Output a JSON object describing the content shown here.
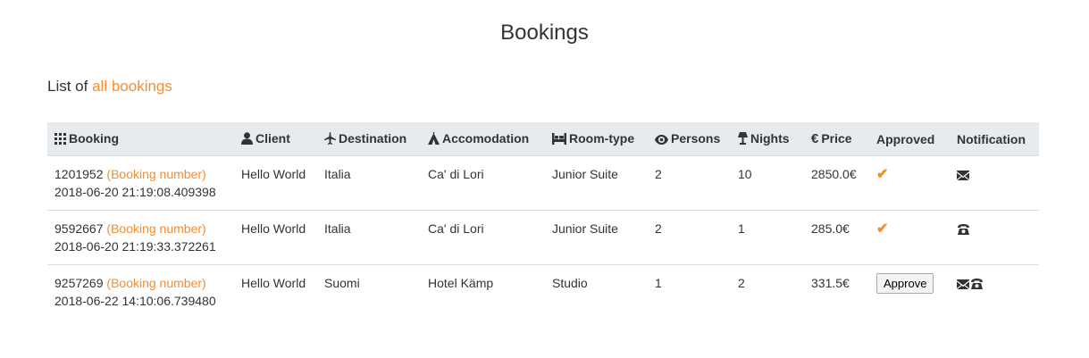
{
  "page": {
    "title": "Bookings"
  },
  "subtitle": {
    "prefix": "List of",
    "accent": "all bookings",
    "accent_color": "#f68c30"
  },
  "table": {
    "headers": {
      "booking": "Booking",
      "client": "Client",
      "destination": "Destination",
      "accommodation": "Accomodation",
      "room_type": "Room-type",
      "persons": "Persons",
      "nights": "Nights",
      "price": "Price",
      "approved": "Approved",
      "notification": "Notification"
    },
    "header_icons": {
      "booking": "grid-icon",
      "client": "user-icon",
      "destination": "plane-icon",
      "accommodation": "tent-icon",
      "room_type": "bed-icon",
      "persons": "eye-icon",
      "nights": "lamp-icon",
      "price": "euro-icon"
    },
    "rows": [
      {
        "number": "1201952",
        "number_label": "(Booking number)",
        "datetime": "2018-06-20 21:19:08.409398",
        "client": "Hello World",
        "destination": "Italia",
        "accommodation": "Ca' di Lori",
        "room_type": "Junior Suite",
        "persons": "2",
        "nights": "10",
        "price": "2850.0€",
        "approved": true,
        "notification": [
          "envelope-icon"
        ]
      },
      {
        "number": "9592667",
        "number_label": "(Booking number)",
        "datetime": "2018-06-20 21:19:33.372261",
        "client": "Hello World",
        "destination": "Italia",
        "accommodation": "Ca' di Lori",
        "room_type": "Junior Suite",
        "persons": "2",
        "nights": "1",
        "price": "285.0€",
        "approved": true,
        "notification": [
          "phone-icon"
        ]
      },
      {
        "number": "9257269",
        "number_label": "(Booking number)",
        "datetime": "2018-06-22 14:10:06.739480",
        "client": "Hello World",
        "destination": "Suomi",
        "accommodation": "Hotel Kämp",
        "room_type": "Studio",
        "persons": "1",
        "nights": "2",
        "price": "331.5€",
        "approved": false,
        "approve_label": "Approve",
        "notification": [
          "envelope-icon",
          "phone-icon"
        ]
      }
    ]
  }
}
